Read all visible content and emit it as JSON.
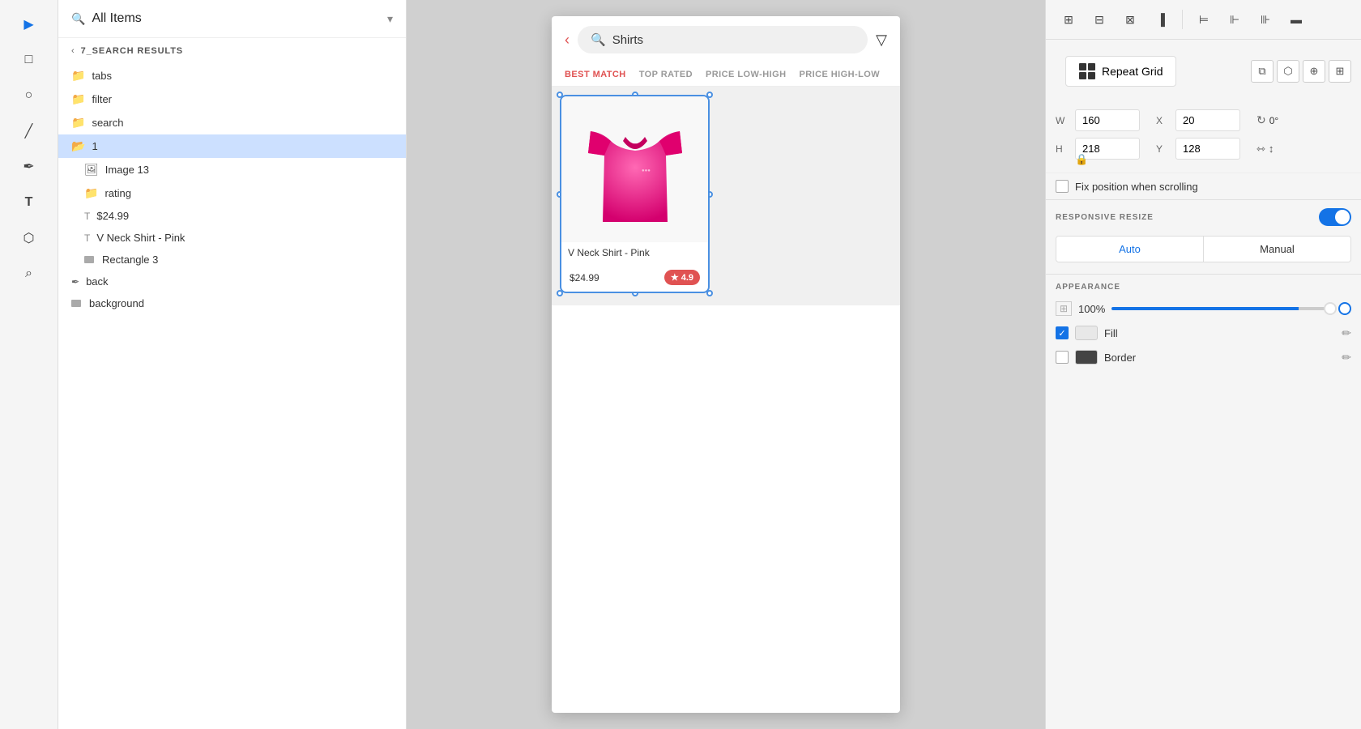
{
  "toolbar": {
    "tools": [
      {
        "name": "select-tool",
        "icon": "▶",
        "active": true
      },
      {
        "name": "rectangle-tool",
        "icon": "□",
        "active": false
      },
      {
        "name": "ellipse-tool",
        "icon": "○",
        "active": false
      },
      {
        "name": "line-tool",
        "icon": "╱",
        "active": false
      },
      {
        "name": "pen-tool",
        "icon": "✒",
        "active": false
      },
      {
        "name": "text-tool",
        "icon": "T",
        "active": false
      },
      {
        "name": "component-tool",
        "icon": "⬡",
        "active": false
      },
      {
        "name": "zoom-tool",
        "icon": "⌕",
        "active": false
      }
    ]
  },
  "left_panel": {
    "title": "All Items",
    "dropdown_icon": "▾",
    "section_label": "7_SEARCH RESULTS",
    "items": [
      {
        "name": "tabs",
        "icon": "folder",
        "level": 0
      },
      {
        "name": "filter",
        "icon": "folder",
        "level": 0
      },
      {
        "name": "search",
        "icon": "folder",
        "level": 0
      },
      {
        "name": "1",
        "icon": "folder",
        "level": 0,
        "active": true
      },
      {
        "name": "Image 13",
        "icon": "image",
        "level": 1
      },
      {
        "name": "rating",
        "icon": "folder",
        "level": 1
      },
      {
        "name": "$24.99",
        "icon": "text",
        "level": 1
      },
      {
        "name": "V Neck Shirt - Pink",
        "icon": "text",
        "level": 1
      },
      {
        "name": "Rectangle 3",
        "icon": "rect",
        "level": 1
      },
      {
        "name": "back",
        "icon": "pen",
        "level": 0
      },
      {
        "name": "background",
        "icon": "rect",
        "level": 0
      }
    ]
  },
  "phone": {
    "search_text": "Shirts",
    "sort_options": [
      {
        "label": "BEST MATCH",
        "active": true
      },
      {
        "label": "TOP RATED",
        "active": false
      },
      {
        "label": "PRICE LOW-HIGH",
        "active": false
      },
      {
        "label": "PRICE HIGH-LOW",
        "active": false
      }
    ],
    "product": {
      "name": "V Neck Shirt - Pink",
      "price": "$24.99",
      "rating": "4.9"
    }
  },
  "right_panel": {
    "repeat_grid_label": "Repeat Grid",
    "dimensions": {
      "w_label": "W",
      "w_value": "160",
      "x_label": "X",
      "x_value": "20",
      "h_label": "H",
      "h_value": "218",
      "y_label": "Y",
      "y_value": "128",
      "rotation": "0°"
    },
    "fix_position_label": "Fix position when scrolling",
    "responsive_resize_label": "RESPONSIVE RESIZE",
    "auto_label": "Auto",
    "manual_label": "Manual",
    "appearance_label": "APPEARANCE",
    "opacity_value": "100%",
    "fill_label": "Fill",
    "border_label": "Border"
  }
}
